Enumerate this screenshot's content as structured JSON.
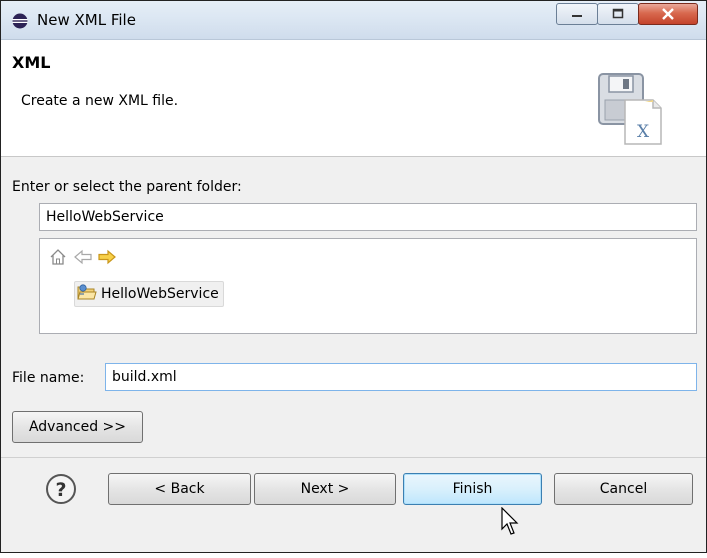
{
  "window": {
    "title": "New XML File",
    "icon": "eclipse-icon",
    "buttons": [
      "minimize",
      "maximize",
      "close"
    ]
  },
  "header": {
    "title": "XML",
    "description": "Create a new XML file.",
    "icon": "xml-file-wizard-icon"
  },
  "parent_folder": {
    "label": "Enter or select the parent folder:",
    "value": "HelloWebService"
  },
  "tree": {
    "nav_icons": [
      "home-icon",
      "back-arrow-icon",
      "forward-arrow-icon"
    ],
    "items": [
      {
        "label": "HelloWebService",
        "icon": "project-folder-icon",
        "selected": true
      }
    ]
  },
  "file_name": {
    "label": "File name:",
    "value": "build.xml"
  },
  "advanced_button": {
    "label": "Advanced >>"
  },
  "footer": {
    "help_icon": "?",
    "back_label": "< Back",
    "next_label": "Next >",
    "finish_label": "Finish",
    "cancel_label": "Cancel"
  },
  "colors": {
    "dialog_bg": "#f0f0f0",
    "header_bg": "#ffffff",
    "default_button": "#bee6fd",
    "close_button": "#c4432b"
  }
}
